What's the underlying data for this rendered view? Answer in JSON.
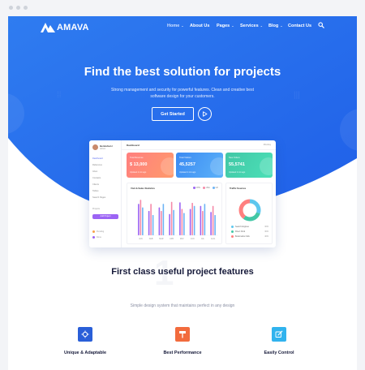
{
  "brand": {
    "name": "AMAVA"
  },
  "nav": {
    "items": [
      {
        "label": "Home",
        "has_caret": true
      },
      {
        "label": "About Us",
        "has_caret": false
      },
      {
        "label": "Pages",
        "has_caret": true
      },
      {
        "label": "Services",
        "has_caret": true
      },
      {
        "label": "Blog",
        "has_caret": true
      },
      {
        "label": "Contact Us",
        "has_caret": false
      }
    ],
    "search_icon": "search-icon"
  },
  "hero": {
    "title": "Find the best solution for projects",
    "subtitle": "Strong management and security for powerful features. Clean and creative best software design for your customers.",
    "cta_label": "Get Started",
    "play_icon": "play-icon",
    "gradient_from": "#2f7cf0",
    "gradient_to": "#1f5fe8"
  },
  "dashboard": {
    "title": "Dashboard",
    "user_name": "Hemisha H",
    "user_role": "Admin",
    "meta": "Monday",
    "sidebar": [
      "Dashboard",
      "Reference",
      "Inbox",
      "Contacts",
      "Clients",
      "Tables",
      "Search Pages"
    ],
    "projects_label": "Projects",
    "add_button": "Add Project",
    "legend": [
      {
        "label": "Pending",
        "color": "#f7a24a"
      },
      {
        "label": "Done",
        "color": "#9c64f4"
      }
    ],
    "cards": [
      {
        "label": "Total Revenue",
        "value": "$ 13,000",
        "sub": "Updated 2 min ago",
        "from": "#ff7f7f",
        "to": "#ff9a6b"
      },
      {
        "label": "Total Visitors",
        "value": "45,5257",
        "sub": "Updated 2 min ago",
        "from": "#3b8af2",
        "to": "#5cb2f9"
      },
      {
        "label": "New Orders",
        "value": "55,5741",
        "sub": "Updated 2 min ago",
        "from": "#42c7a6",
        "to": "#4be0b7"
      }
    ],
    "chart_title": "Visit & Sales Statistics",
    "donut_title": "Traffic Sources",
    "donut_items": [
      {
        "label": "Search Engines",
        "pct": "30%",
        "color": "#5dc7ee"
      },
      {
        "label": "Direct Click",
        "pct": "30%",
        "color": "#42c7a6"
      },
      {
        "label": "Bookmarks Click",
        "pct": "40%",
        "color": "#ff7f7f"
      }
    ]
  },
  "chart_data": {
    "type": "bar",
    "categories": [
      "JAN",
      "FEB",
      "MAR",
      "APR",
      "MAY",
      "JUN",
      "JUL",
      "AUG"
    ],
    "series": [
      {
        "name": "CHN",
        "color": "#9c64f4",
        "values": [
          62,
          48,
          55,
          42,
          65,
          52,
          58,
          46
        ]
      },
      {
        "name": "USA",
        "color": "#f58aa8",
        "values": [
          70,
          62,
          48,
          66,
          52,
          64,
          48,
          58
        ]
      },
      {
        "name": "UK",
        "color": "#6db4f5",
        "values": [
          55,
          40,
          62,
          50,
          44,
          58,
          62,
          40
        ]
      }
    ],
    "ylim": [
      0,
      80
    ]
  },
  "features": {
    "bg_number": "1",
    "title": "First class useful project features",
    "subtitle": "Simple design system that maintains perfect in any design",
    "items": [
      {
        "label": "Unique & Adaptable",
        "icon": "crosshair-icon",
        "color": "#2a5fd8"
      },
      {
        "label": "Best Performance",
        "icon": "paint-roller-icon",
        "color": "#f26b3d"
      },
      {
        "label": "Easily Control",
        "icon": "edit-icon",
        "color": "#31b3ee"
      }
    ]
  }
}
